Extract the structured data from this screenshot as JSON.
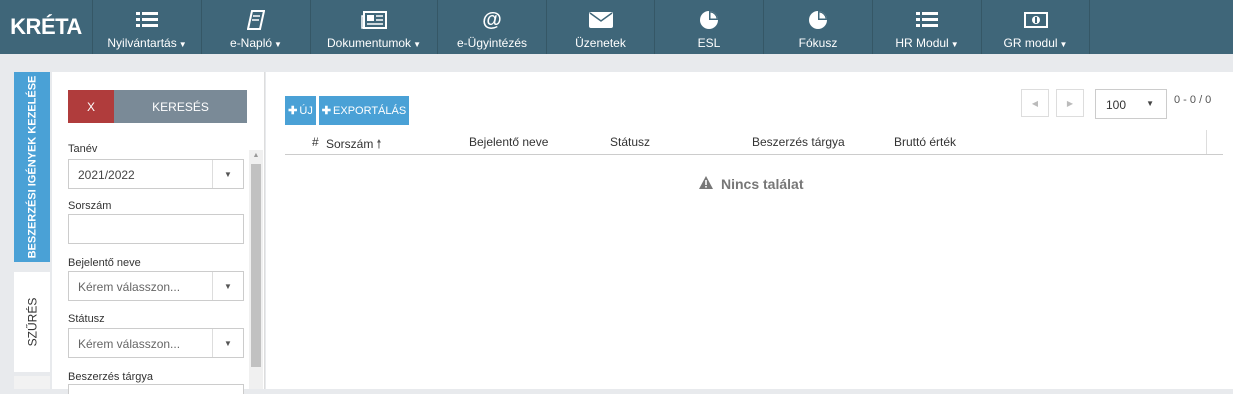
{
  "app": {
    "logo": "KRÉTA"
  },
  "nav": [
    {
      "label": "Nyilvántartás",
      "icon": "list-icon",
      "dropdown": true
    },
    {
      "label": "e-Napló",
      "icon": "book-icon",
      "dropdown": true
    },
    {
      "label": "Dokumentumok",
      "icon": "newspaper-icon",
      "dropdown": true
    },
    {
      "label": "e-Ügyintézés",
      "icon": "at-icon",
      "dropdown": false
    },
    {
      "label": "Üzenetek",
      "icon": "envelope-icon",
      "dropdown": false
    },
    {
      "label": "ESL",
      "icon": "pie-chart-icon",
      "dropdown": false
    },
    {
      "label": "Fókusz",
      "icon": "pie-chart-icon",
      "dropdown": false
    },
    {
      "label": "HR Modul",
      "icon": "list-icon",
      "dropdown": true
    },
    {
      "label": "GR modul",
      "icon": "money-icon",
      "dropdown": true
    }
  ],
  "side_tabs": {
    "main": "BESZERZÉSI IGÉNYEK KEZELÉSE",
    "filter": "SZŰRÉS"
  },
  "filter": {
    "clear_label": "X",
    "search_label": "KERESÉS",
    "fields": {
      "tanev": {
        "label": "Tanév",
        "value": "2021/2022"
      },
      "sorszam": {
        "label": "Sorszám",
        "value": ""
      },
      "bejelento": {
        "label": "Bejelentő neve",
        "placeholder": "Kérem válasszon..."
      },
      "statusz": {
        "label": "Státusz",
        "placeholder": "Kérem válasszon..."
      },
      "targy": {
        "label": "Beszerzés tárgya"
      }
    }
  },
  "toolbar": {
    "new_label": "ÚJ",
    "export_label": "EXPORTÁLÁS"
  },
  "pager": {
    "page_size": "100",
    "info": "0 - 0 / 0"
  },
  "table": {
    "columns": [
      "#",
      "Sorszám",
      "Bejelentő neve",
      "Státusz",
      "Beszerzés tárgya",
      "Bruttó érték"
    ],
    "sorted_column": "Sorszám",
    "rows": [],
    "empty_message": "Nincs találat"
  },
  "colors": {
    "nav_bg": "#3f6679",
    "accent_blue": "#4aa1d6",
    "clear_red": "#b03c3c",
    "search_grey": "#7a8a97"
  }
}
